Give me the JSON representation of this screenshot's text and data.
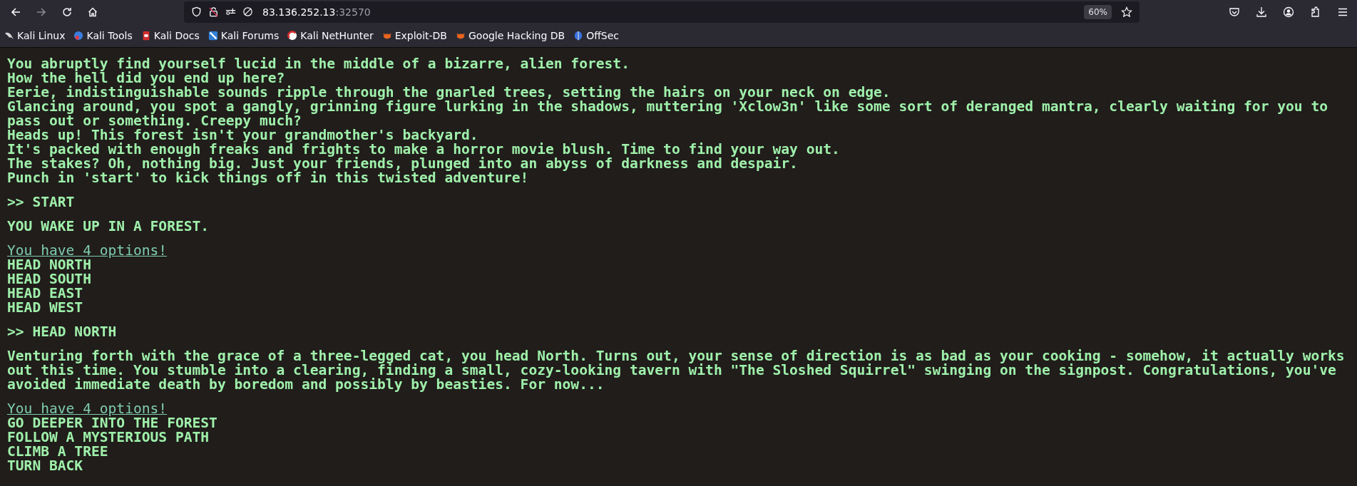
{
  "browser": {
    "url_host": "83.136.252.13",
    "url_port": ":32570",
    "zoom": "60%",
    "bookmarks": [
      "Kali Linux",
      "Kali Tools",
      "Kali Docs",
      "Kali Forums",
      "Kali NetHunter",
      "Exploit-DB",
      "Google Hacking DB",
      "OffSec"
    ]
  },
  "terminal": [
    {
      "kind": "text",
      "lines": [
        "You abruptly find yourself lucid in the middle of a bizarre, alien forest.",
        "How the hell did you end up here?",
        "Eerie, indistinguishable sounds ripple through the gnarled trees, setting the hairs on your neck on edge.",
        "Glancing around, you spot a gangly, grinning figure lurking in the shadows, muttering 'Xclow3n' like some sort of deranged mantra, clearly waiting for you to pass out or something. Creepy much?",
        "Heads up! This forest isn't your grandmother's backyard.",
        "It's packed with enough freaks and frights to make a horror movie blush. Time to find your way out.",
        "The stakes? Oh, nothing big. Just your friends, plunged into an abyss of darkness and despair.",
        "Punch in 'start' to kick things off in this twisted adventure!"
      ]
    },
    {
      "kind": "command",
      "text": ">> START"
    },
    {
      "kind": "text",
      "lines": [
        "YOU WAKE UP IN A FOREST."
      ]
    },
    {
      "kind": "options",
      "heading": "You have 4 options!",
      "options": [
        "HEAD NORTH",
        "HEAD SOUTH",
        "HEAD EAST",
        "HEAD WEST"
      ]
    },
    {
      "kind": "command",
      "text": ">> HEAD NORTH"
    },
    {
      "kind": "text",
      "lines": [
        "Venturing forth with the grace of a three-legged cat, you head North. Turns out, your sense of direction is as bad as your cooking - somehow, it actually works out this time. You stumble into a clearing, finding a small, cozy-looking tavern with \"The Sloshed Squirrel\" swinging on the signpost. Congratulations, you've avoided immediate death by boredom and possibly by beasties. For now..."
      ]
    },
    {
      "kind": "options",
      "heading": "You have 4 options!",
      "options": [
        "GO DEEPER INTO THE FOREST",
        "FOLLOW A MYSTERIOUS PATH",
        "CLIMB A TREE",
        "TURN BACK"
      ]
    }
  ]
}
